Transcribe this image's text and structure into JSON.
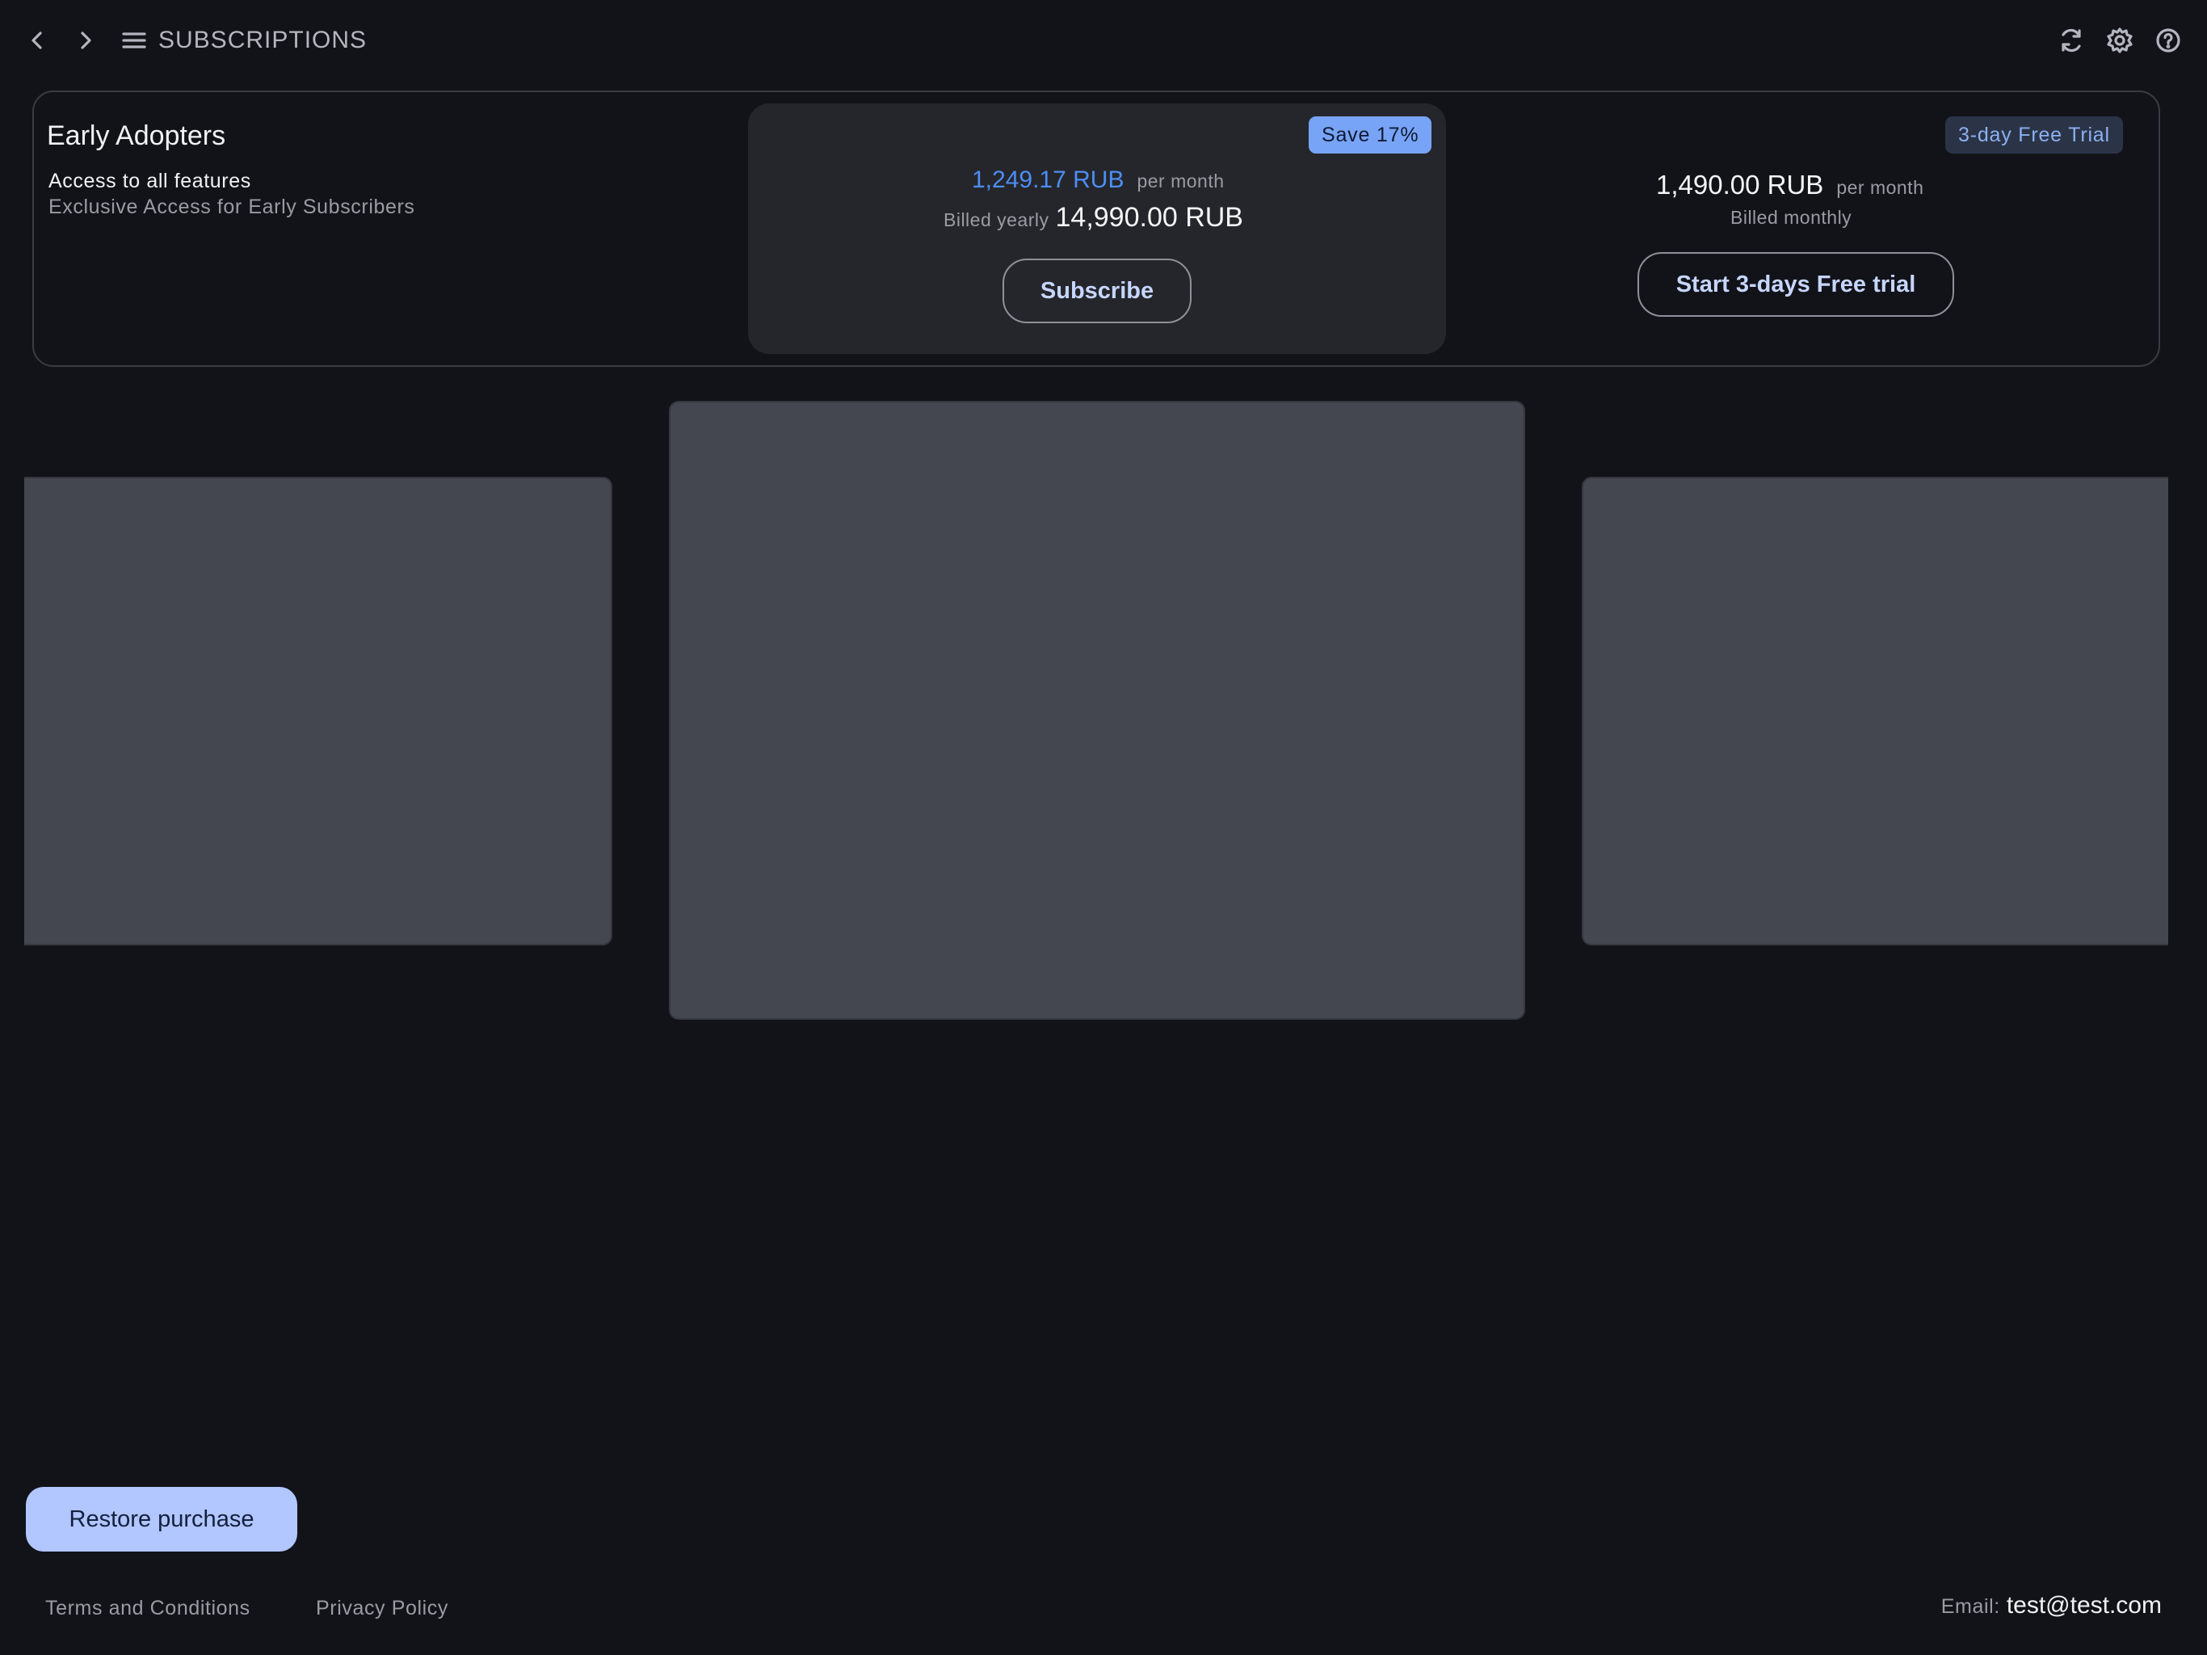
{
  "header": {
    "title": "SUBSCRIPTIONS",
    "icons": [
      "back-icon",
      "forward-icon",
      "menu-icon",
      "refresh-icon",
      "settings-icon",
      "help-icon"
    ]
  },
  "plan": {
    "name": "Early Adopters",
    "description": "Access to all features",
    "subtitle": "Exclusive Access for Early Subscribers"
  },
  "yearly": {
    "badge": "Save 17%",
    "monthly_price": "1,249.17 RUB",
    "per_month": "per month",
    "billed_label": "Billed yearly",
    "total": "14,990.00 RUB",
    "button": "Subscribe"
  },
  "monthly": {
    "badge": "3-day Free Trial",
    "price": "1,490.00 RUB",
    "per_month": "per month",
    "billed_label": "Billed monthly",
    "button": "Start 3-days Free trial"
  },
  "footer": {
    "restore_button": "Restore purchase",
    "terms": "Terms and Conditions",
    "privacy": "Privacy Policy",
    "email_label": "Email:",
    "email_value": "test@test.com"
  },
  "colors": {
    "background": "#121319",
    "accent_blue": "#4d8ef5",
    "save_badge": "#78a4f7",
    "restore_button": "#b2c6ff",
    "placeholder": "#444750"
  }
}
